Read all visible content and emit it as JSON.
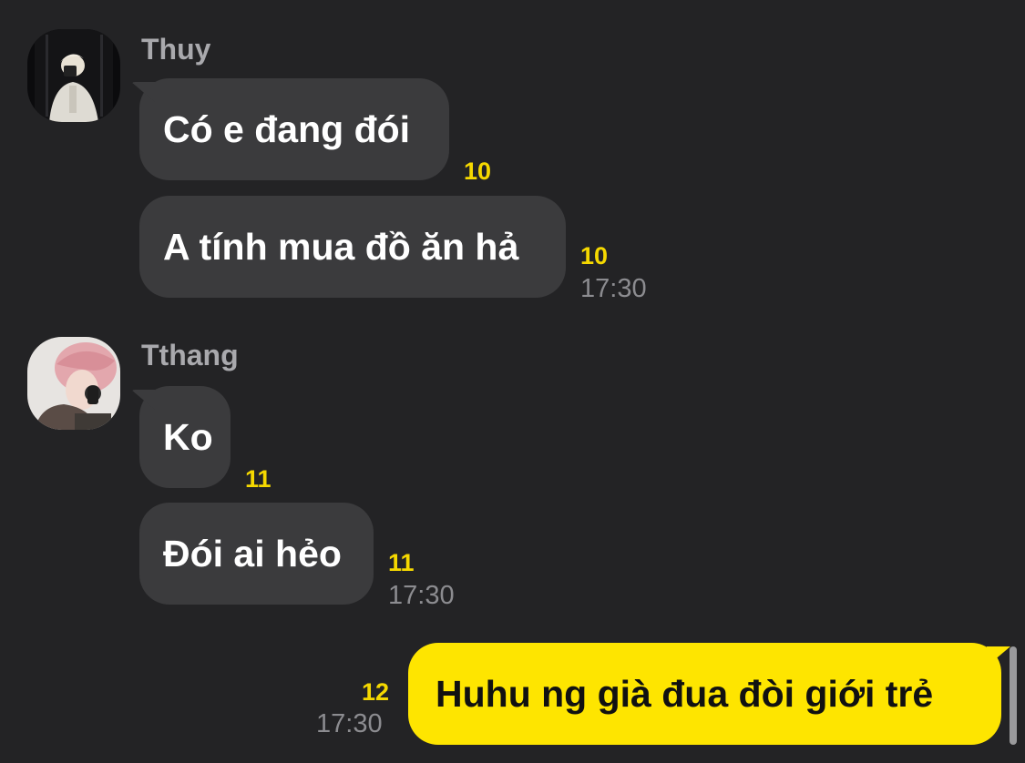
{
  "messages": [
    {
      "sender": "Thuy",
      "avatar_icon": "profile-photo-blond-person-in-white-jacket",
      "bubbles": [
        {
          "text": "Có e đang đói",
          "unread": "10",
          "time": ""
        },
        {
          "text": "A tính mua đồ ăn hả",
          "unread": "10",
          "time": "17:30"
        }
      ]
    },
    {
      "sender": "Tthang",
      "avatar_icon": "profile-photo-pink-haired-person-on-phone",
      "bubbles": [
        {
          "text": "Ko",
          "unread": "11",
          "time": ""
        },
        {
          "text": "Đói ai hẻo",
          "unread": "11",
          "time": "17:30"
        }
      ]
    },
    {
      "sender": "",
      "mine": true,
      "bubbles": [
        {
          "text": "Huhu ng già đua đòi giới trẻ",
          "unread": "12",
          "time": "17:30"
        }
      ]
    }
  ],
  "colors": {
    "background": "#232325",
    "incoming_bubble": "#3b3b3d",
    "outgoing_bubble": "#fee500",
    "unread_count": "#f5d800",
    "timestamp": "#8c8c90"
  }
}
